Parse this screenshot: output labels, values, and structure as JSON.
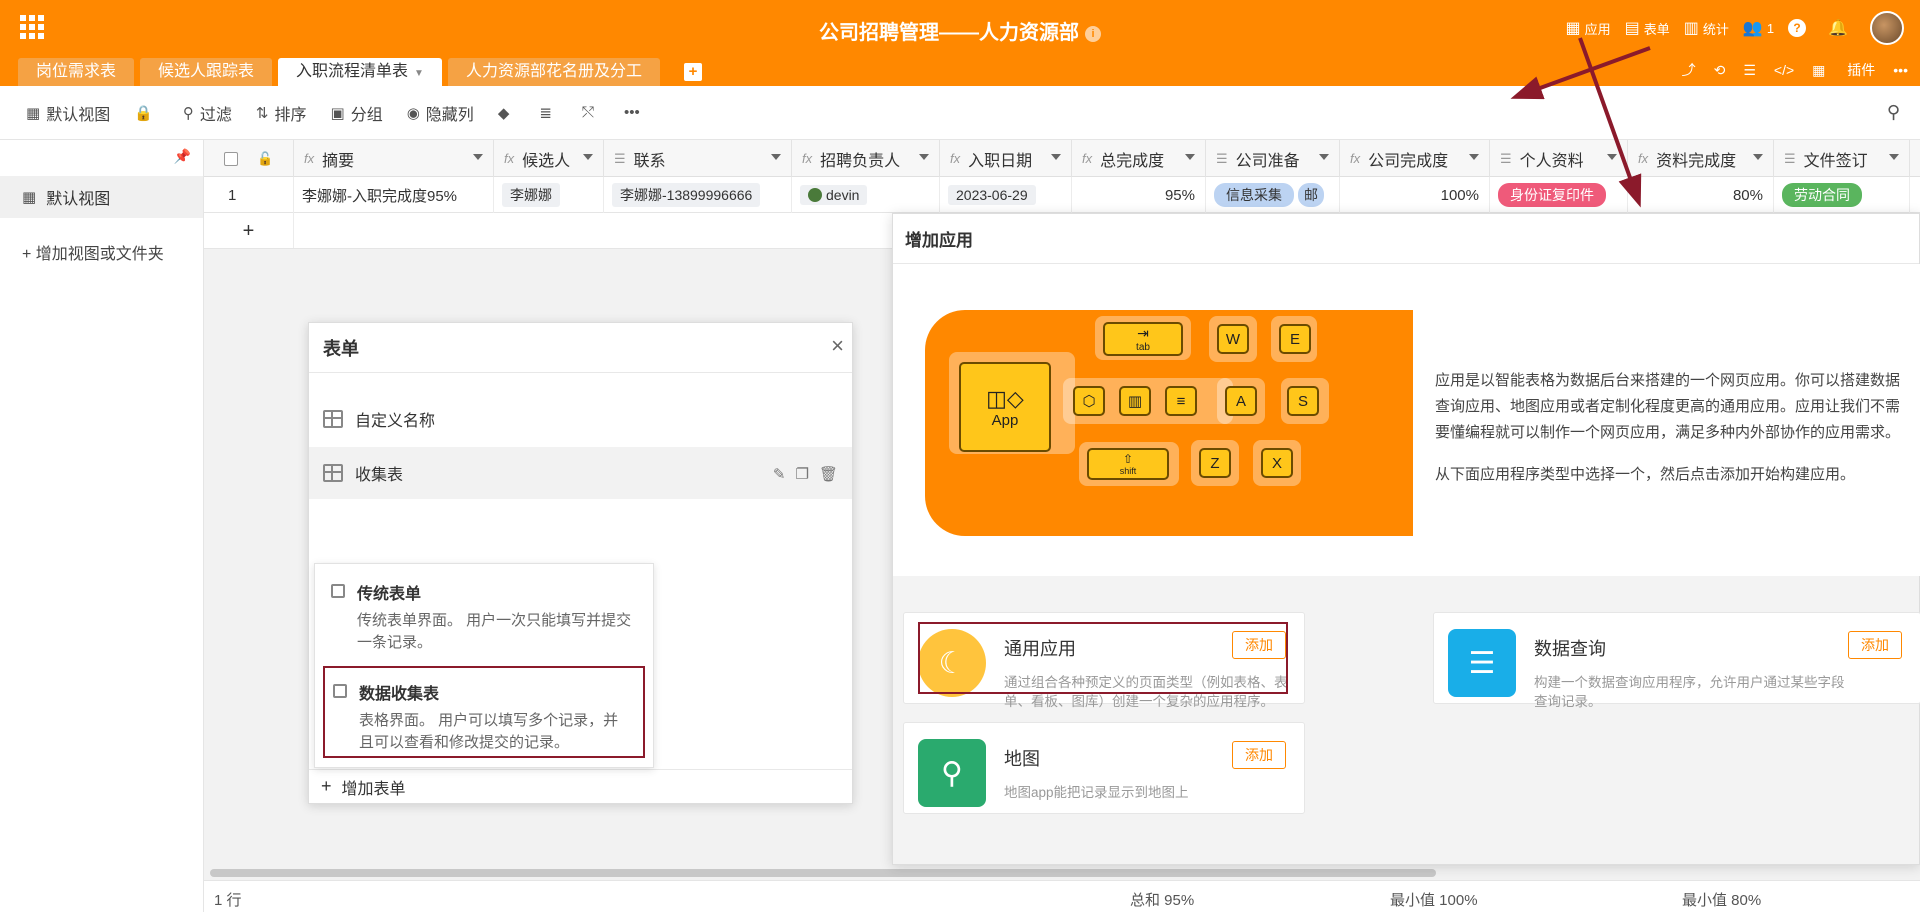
{
  "header": {
    "title": "公司招聘管理——人力资源部",
    "actions": [
      "应用",
      "表单",
      "统计",
      "1"
    ],
    "brand_color": "#ff8800"
  },
  "tabs": [
    "岗位需求表",
    "候选人跟踪表",
    "入职流程清单表",
    "人力资源部花名册及分工"
  ],
  "tab_right": {
    "plugin": "插件"
  },
  "toolbar": {
    "default_view": "默认视图",
    "filter": "过滤",
    "sort": "排序",
    "group": "分组",
    "hide_cols": "隐藏列"
  },
  "sidebar": {
    "view": "默认视图",
    "add_view": "增加视图或文件夹"
  },
  "grid": {
    "columns": [
      "摘要",
      "候选人",
      "联系",
      "招聘负责人",
      "入职日期",
      "总完成度",
      "公司准备",
      "公司完成度",
      "个人资料",
      "资料完成度",
      "文件签订"
    ],
    "row": {
      "index": "1",
      "summary": "李娜娜-入职完成度95%",
      "candidate": "李娜娜",
      "contact": "李娜娜-13899996666",
      "owner": "devin",
      "date": "2023-06-29",
      "total": "95%",
      "company_prep": "信息采集",
      "company_prep_more": "邮",
      "company_done": "100%",
      "personal": "身份证复印件",
      "personal_done": "80%",
      "doc_signed": "劳动合同"
    }
  },
  "statusbar": {
    "rows": "1 行",
    "sum": "总和 95%",
    "min1": "最小值 100%",
    "min2": "最小值 80%"
  },
  "form_panel": {
    "title": "表单",
    "items": [
      "自定义名称",
      "收集表"
    ],
    "add": "增加表单",
    "options": [
      {
        "title": "传统表单",
        "desc": "传统表单界面。 用户一次只能填写并提交一条记录。"
      },
      {
        "title": "数据收集表",
        "desc": "表格界面。 用户可以填写多个记录，并且可以查看和修改提交的记录。"
      }
    ]
  },
  "app_dialog": {
    "title": "增加应用",
    "intro1": "应用是以智能表格为数据后台来搭建的一个网页应用。你可以搭建数据",
    "intro2": "查询应用、地图应用或者定制化程度更高的通用应用。应用让我们不需",
    "intro3": "要懂编程就可以制作一个网页应用，满足多种内外部协作的应用需求。",
    "intro4": "从下面应用程序类型中选择一个，然后点击添加开始构建应用。",
    "keys": {
      "tab": "tab",
      "shift": "shift",
      "app": "App",
      "W": "W",
      "E": "E",
      "A": "A",
      "S": "S",
      "Z": "Z",
      "X": "X"
    },
    "apps": [
      {
        "name": "通用应用",
        "desc": "通过组合各种预定义的页面类型（例如表格、表单、看板、图库）创建一个复杂的应用程序。",
        "add": "添加"
      },
      {
        "name": "数据查询",
        "desc": "构建一个数据查询应用程序，允许用户通过某些字段查询记录。",
        "add": "添加"
      },
      {
        "name": "地图",
        "desc": "地图app能把记录显示到地图上",
        "add": "添加"
      }
    ]
  }
}
